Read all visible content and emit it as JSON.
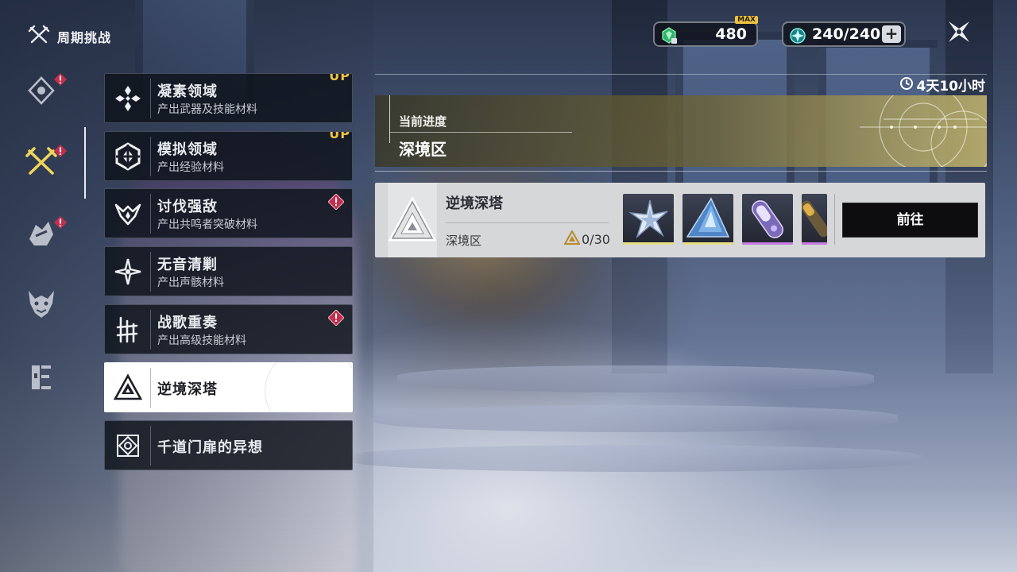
{
  "header": {
    "title": "周期挑战"
  },
  "resources": {
    "crystal": {
      "value": "480",
      "badge": "MAX",
      "icon": "crystal-solvent-icon"
    },
    "waveplate": {
      "value": "240/240",
      "icon": "waveplate-icon",
      "add_label": "+"
    }
  },
  "rail": {
    "items": [
      {
        "icon": "tacet-diamond-icon",
        "alert": true
      },
      {
        "icon": "crossed-swords-icon",
        "alert": true,
        "selected": true
      },
      {
        "icon": "beast-claw-icon",
        "alert": true
      },
      {
        "icon": "dragon-head-icon",
        "alert": false
      },
      {
        "icon": "doorway-icon",
        "alert": false
      }
    ]
  },
  "categories": [
    {
      "name": "凝素领域",
      "desc": "产出武器及技能材料",
      "badge": "UP",
      "icon": "forgery-diamond-icon"
    },
    {
      "name": "模拟领域",
      "desc": "产出经验材料",
      "badge": "UP",
      "icon": "simulation-shield-icon"
    },
    {
      "name": "讨伐强敌",
      "desc": "产出共鸣者突破材料",
      "alert": true,
      "icon": "boss-horns-icon"
    },
    {
      "name": "无音清剿",
      "desc": "产出声骸材料",
      "icon": "tacet-star-icon"
    },
    {
      "name": "战歌重奏",
      "desc": "产出高级技能材料",
      "alert": true,
      "icon": "warsong-glyph-icon"
    },
    {
      "name": "逆境深塔",
      "selected": true,
      "icon": "tower-triangle-icon"
    },
    {
      "name": "千道门扉的异想",
      "icon": "thousand-gates-icon"
    }
  ],
  "panel": {
    "timer": "4天10小时",
    "progress_label": "当前进度",
    "progress_value": "深境区",
    "card": {
      "name": "逆境深塔",
      "zone": "深境区",
      "count": "0/30",
      "go_label": "前往",
      "rewards": [
        {
          "icon": "star-shard-icon",
          "rarity_color": "#e8e088"
        },
        {
          "icon": "blue-crystal-icon",
          "rarity_color": "#e8e088"
        },
        {
          "icon": "purple-capsule-icon",
          "rarity_color": "#c57ae0"
        },
        {
          "icon": "golden-rod-icon",
          "rarity_color": "#c57ae0"
        }
      ]
    }
  }
}
